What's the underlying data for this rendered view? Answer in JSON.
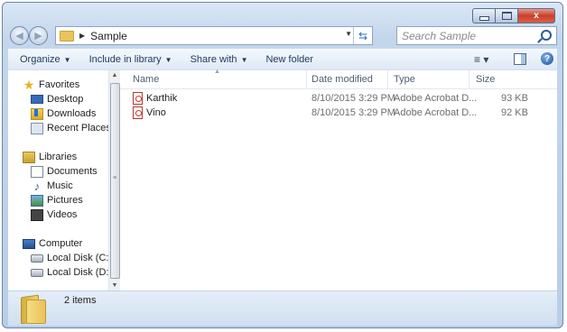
{
  "window": {
    "controls": {
      "minimize": "",
      "maximize": "",
      "close": "x"
    }
  },
  "address_bar": {
    "breadcrumb": [
      "Sample"
    ],
    "refresh_icon": "refresh-icon"
  },
  "search": {
    "placeholder": "Search Sample"
  },
  "toolbar": {
    "organize": "Organize",
    "include_in_library": "Include in library",
    "share_with": "Share with",
    "new_folder": "New folder"
  },
  "sidebar": {
    "favorites": {
      "label": "Favorites",
      "items": [
        {
          "label": "Desktop",
          "icon": "desktop-icon"
        },
        {
          "label": "Downloads",
          "icon": "downloads-icon"
        },
        {
          "label": "Recent Places",
          "icon": "recent-places-icon"
        }
      ]
    },
    "libraries": {
      "label": "Libraries",
      "items": [
        {
          "label": "Documents",
          "icon": "documents-icon"
        },
        {
          "label": "Music",
          "icon": "music-icon"
        },
        {
          "label": "Pictures",
          "icon": "pictures-icon"
        },
        {
          "label": "Videos",
          "icon": "videos-icon"
        }
      ]
    },
    "computer": {
      "label": "Computer",
      "items": [
        {
          "label": "Local Disk (C:)",
          "icon": "disk-icon"
        },
        {
          "label": "Local Disk (D:)",
          "icon": "disk-icon"
        }
      ]
    }
  },
  "file_list": {
    "columns": {
      "name": "Name",
      "date_modified": "Date modified",
      "type": "Type",
      "size": "Size"
    },
    "rows": [
      {
        "name": "Karthik",
        "date_modified": "8/10/2015 3:29 PM",
        "type": "Adobe Acrobat D...",
        "size": "93 KB"
      },
      {
        "name": "Vino",
        "date_modified": "8/10/2015 3:29 PM",
        "type": "Adobe Acrobat D...",
        "size": "92 KB"
      }
    ]
  },
  "status": {
    "item_count": "2 items"
  }
}
